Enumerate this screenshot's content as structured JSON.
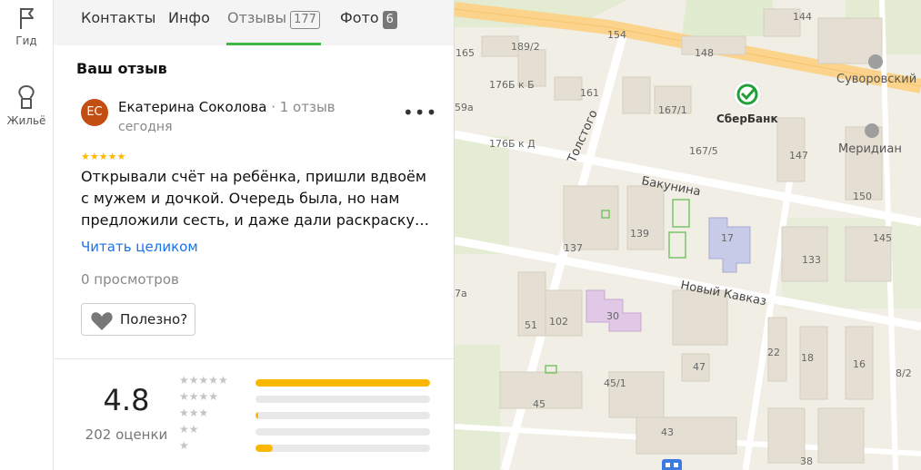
{
  "rail": {
    "items": [
      {
        "label": "Гид",
        "icon": "flag-icon"
      },
      {
        "label": "Жильё",
        "icon": "house-icon"
      }
    ]
  },
  "tabs": [
    {
      "label": "Контакты"
    },
    {
      "label": "Инфо"
    },
    {
      "label": "Отзывы",
      "count": "177",
      "active": true
    },
    {
      "label": "Фото",
      "count": "6"
    }
  ],
  "review": {
    "section_title": "Ваш отзыв",
    "avatar_initials": "ЕС",
    "avatar_color": "#c24e12",
    "author_name": "Екатерина Соколова",
    "author_reviews": "· 1 отзыв",
    "date": "сегодня",
    "stars": 5,
    "text": "Открывали счёт на ребёнка, пришли вдвоём с мужем и дочкой. Очередь была, но нам предложили сесть, и даже дали раскраску…",
    "read_more": "Читать целиком",
    "views": "0 просмотров",
    "useful_label": "Полезно?"
  },
  "rating": {
    "value": "4.8",
    "count_label": "202 оценки",
    "distribution": [
      {
        "stars": 5,
        "fraction": 1.0
      },
      {
        "stars": 4,
        "fraction": 0.0
      },
      {
        "stars": 3,
        "fraction": 0.01
      },
      {
        "stars": 2,
        "fraction": 0.0
      },
      {
        "stars": 1,
        "fraction": 0.1
      }
    ],
    "accent_color": "#fcb800"
  },
  "map": {
    "labels": {
      "n144": "144",
      "n154": "154",
      "n1892": "189/2",
      "n148": "148",
      "n165": "165",
      "n176bb": "176Б к Б",
      "n161": "161",
      "n1671": "167/1",
      "n59a": "59а",
      "n176bd": "176Б к Д",
      "n1675": "167/5",
      "n147": "147",
      "n150": "150",
      "n139": "139",
      "n137": "137",
      "n17": "17",
      "n145": "145",
      "n133": "133",
      "n102": "102",
      "n51": "51",
      "n30": "30",
      "n7a": "7а",
      "n22": "22",
      "n18": "18",
      "n16": "16",
      "n82": "8/2",
      "n47": "47",
      "n451": "45/1",
      "n45": "45",
      "n43": "43",
      "n38": "38"
    },
    "streets": {
      "tolstogo": "Толстого",
      "bakunina": "Бакунина",
      "novy_kavkaz": "Новый Кавказ"
    },
    "pois": {
      "sberbank": "СберБанк",
      "suvorovsky": "Суворовский",
      "meridian": "Меридиан"
    },
    "sber_color": "#21a038"
  }
}
